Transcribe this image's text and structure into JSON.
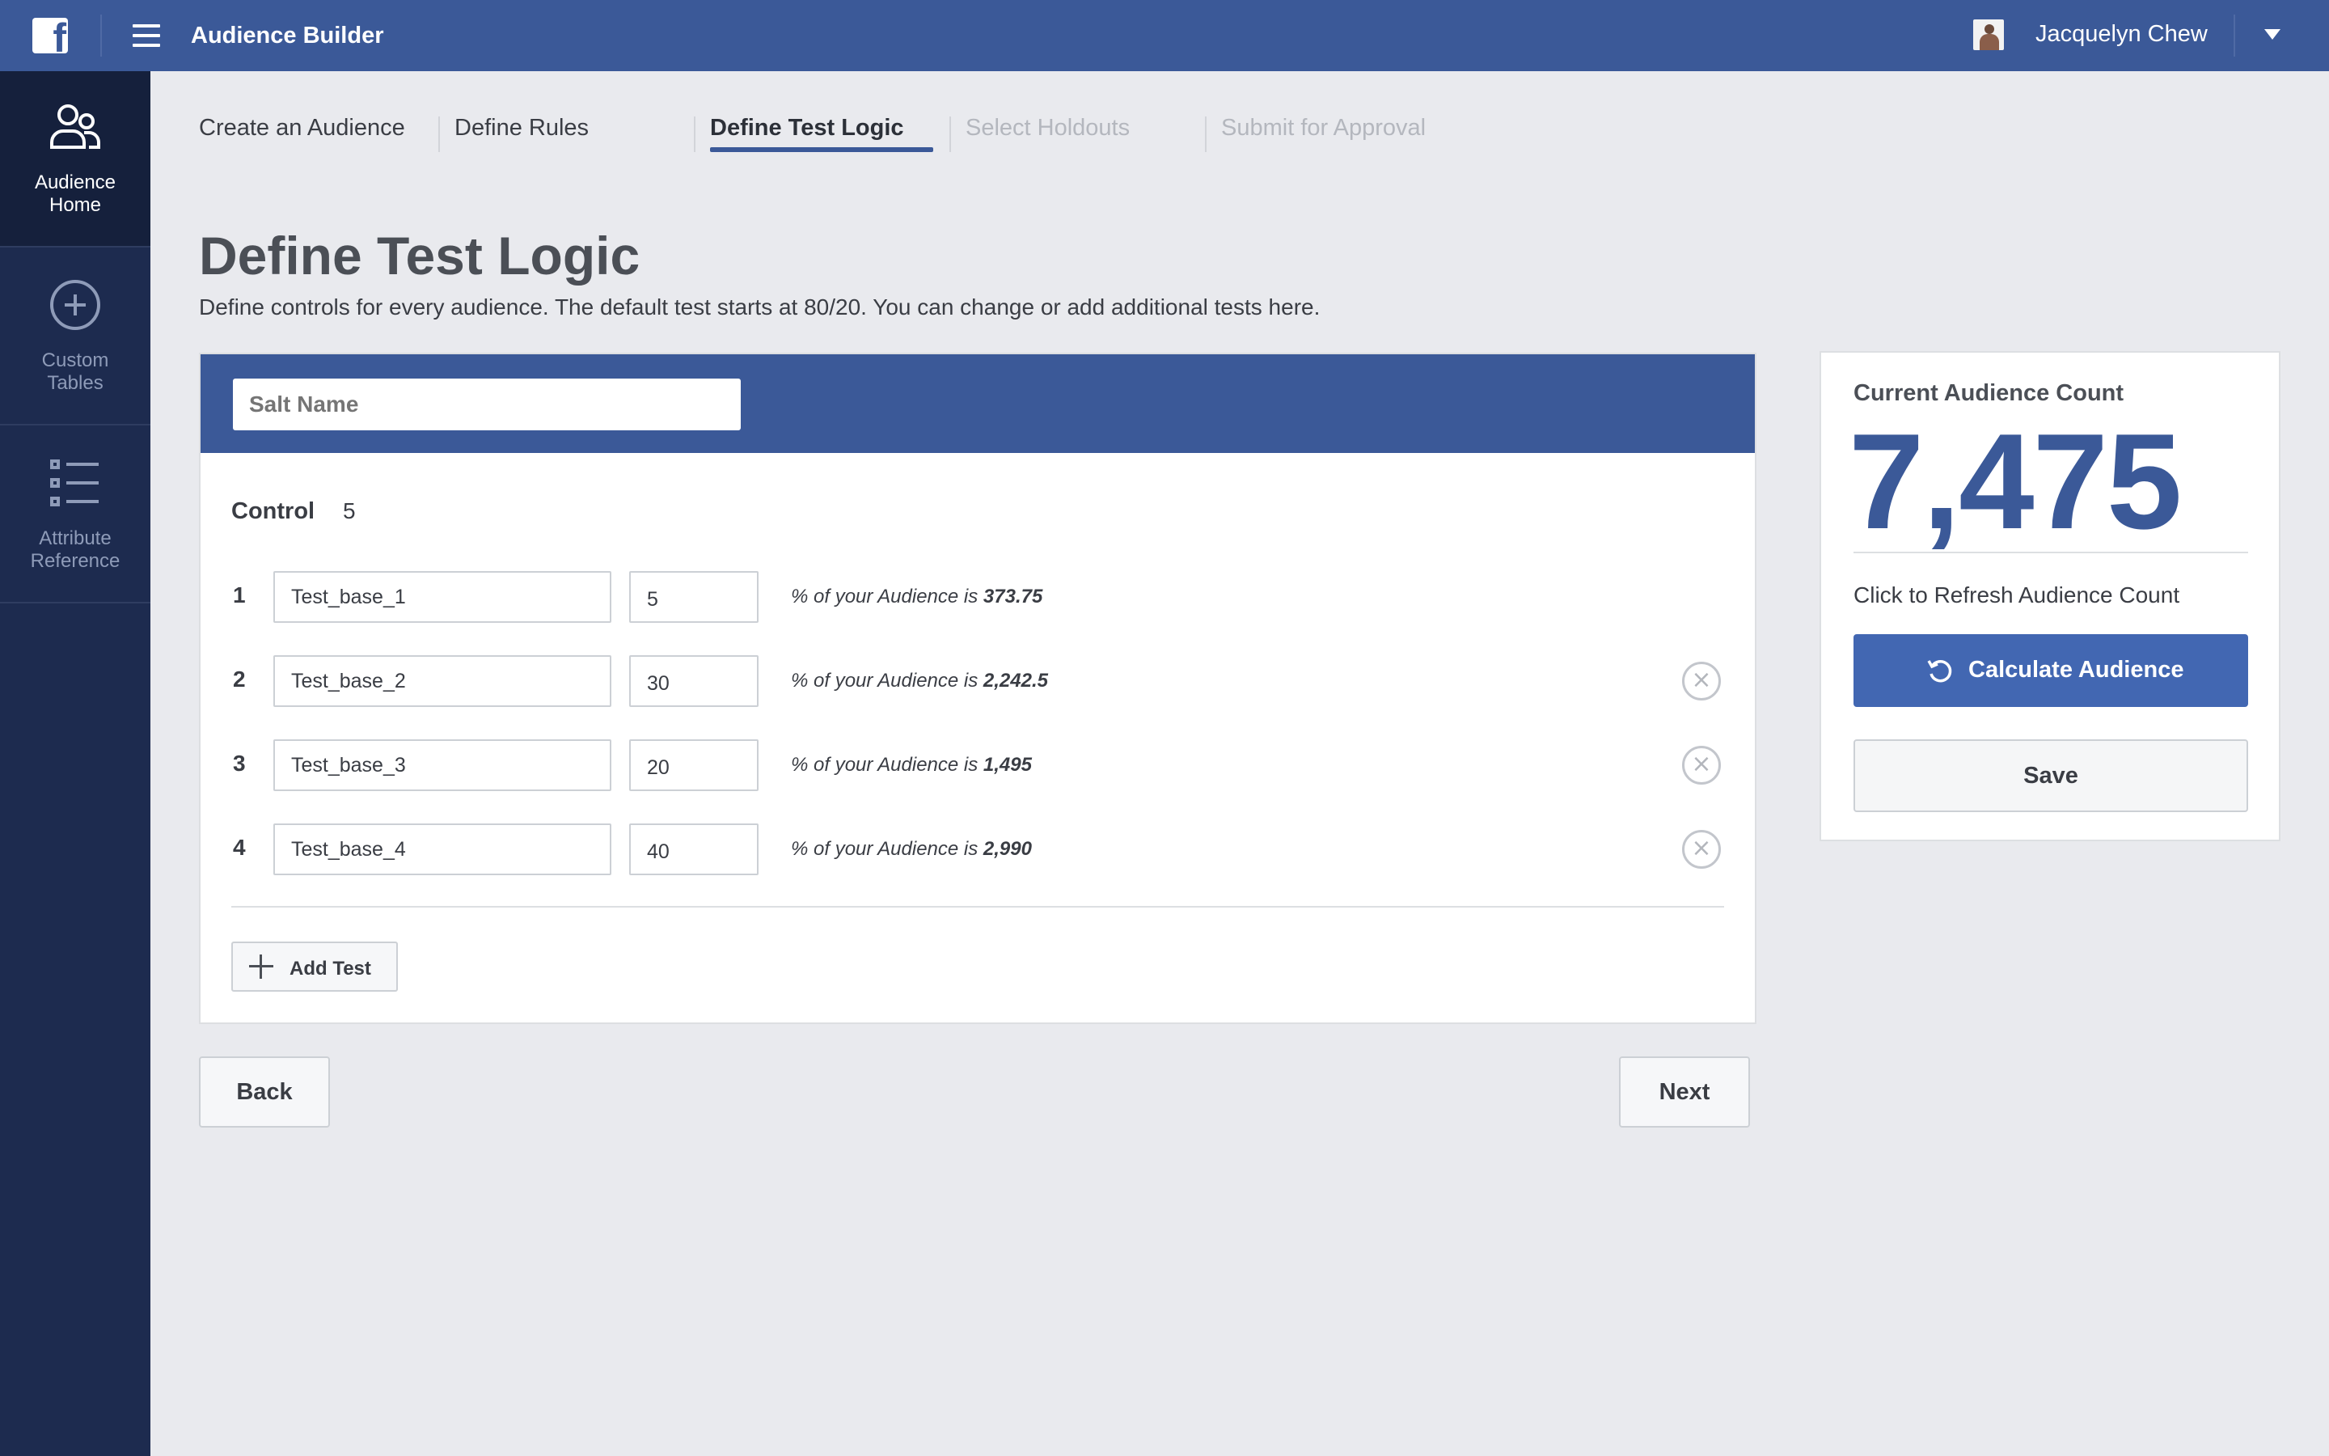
{
  "header": {
    "app_title": "Audience Builder",
    "user_name": "Jacquelyn Chew"
  },
  "sidebar": {
    "items": [
      {
        "label": "Audience Home",
        "icon": "people-icon",
        "active": true
      },
      {
        "label": "Custom Tables",
        "icon": "plus-circle-icon",
        "active": false
      },
      {
        "label": "Attribute Reference",
        "icon": "list-icon",
        "active": false
      }
    ]
  },
  "steps": [
    {
      "label": "Create an Audience",
      "state": "done"
    },
    {
      "label": "Define Rules",
      "state": "done"
    },
    {
      "label": "Define Test Logic",
      "state": "active"
    },
    {
      "label": "Select Holdouts",
      "state": "disabled"
    },
    {
      "label": "Submit for Approval",
      "state": "disabled"
    }
  ],
  "page": {
    "title": "Define Test Logic",
    "description": "Define controls for every audience. The default test starts at 80/20. You can change or add additional tests here."
  },
  "card": {
    "salt_name_placeholder": "Salt Name",
    "control_label": "Control",
    "control_value": "5",
    "tests": [
      {
        "num": "1",
        "name": "Test_base_1",
        "pct": "5",
        "text_prefix": "% of your Audience is ",
        "result": "373.75",
        "removable": false
      },
      {
        "num": "2",
        "name": "Test_base_2",
        "pct": "30",
        "text_prefix": "% of your Audience is ",
        "result": "2,242.5",
        "removable": true
      },
      {
        "num": "3",
        "name": "Test_base_3",
        "pct": "20",
        "text_prefix": "% of your Audience is ",
        "result": "1,495",
        "removable": true
      },
      {
        "num": "4",
        "name": "Test_base_4",
        "pct": "40",
        "text_prefix": "% of your Audience is ",
        "result": "2,990",
        "removable": true
      }
    ],
    "add_test_label": "Add Test"
  },
  "nav": {
    "back_label": "Back",
    "next_label": "Next"
  },
  "panel": {
    "title": "Current Audience Count",
    "count": "7,475",
    "refresh_text": "Click to Refresh Audience Count",
    "calculate_label": "Calculate Audience",
    "save_label": "Save"
  },
  "colors": {
    "brand": "#3b5998",
    "button_primary": "#4267b2",
    "sidebar": "#1d2b4f"
  }
}
